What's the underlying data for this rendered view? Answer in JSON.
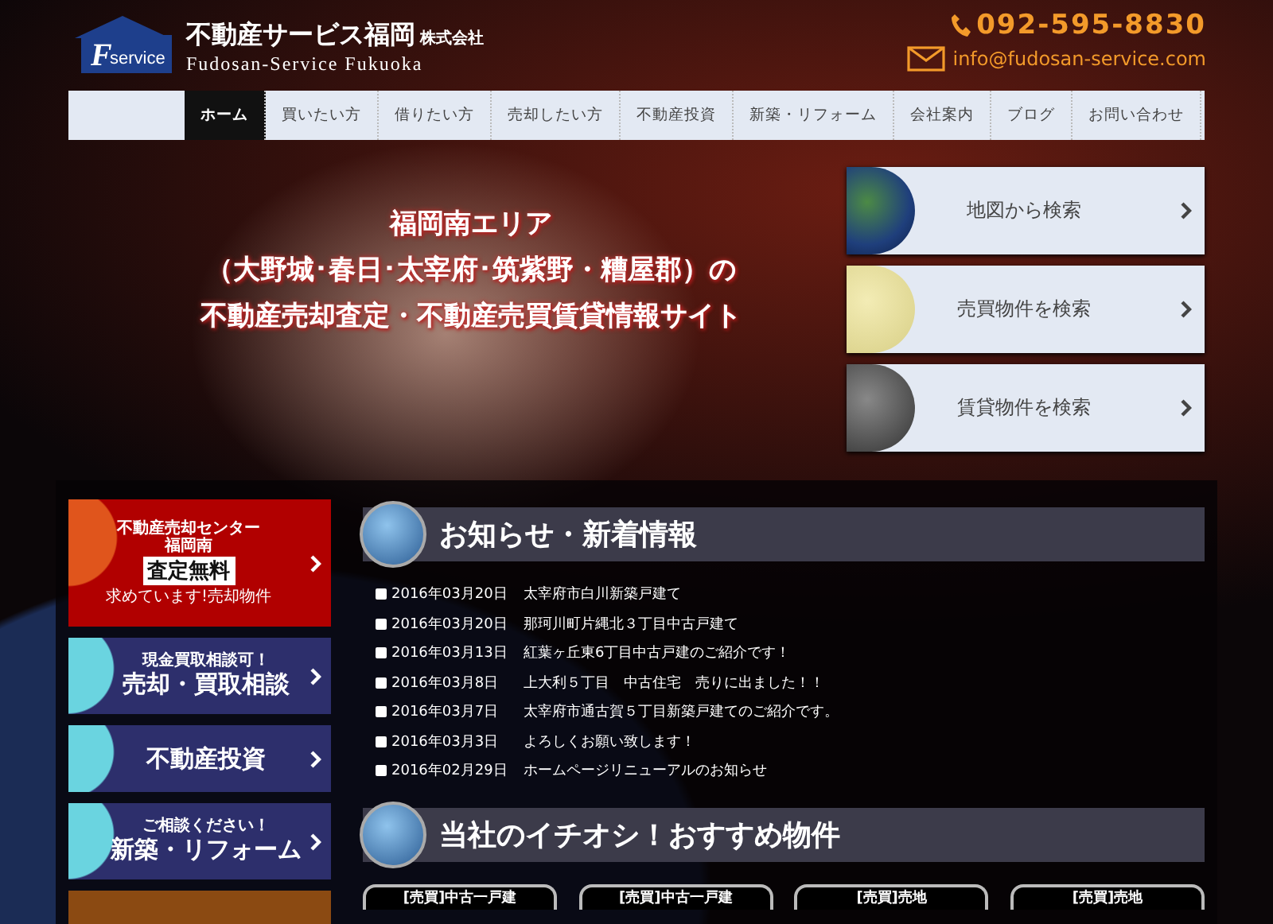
{
  "header": {
    "logo_text": "service",
    "logo_letter": "F",
    "company": "不動産サービス福岡",
    "company_suffix": "株式会社",
    "company_en": "Fudosan-Service Fukuoka",
    "phone": "092-595-8830",
    "email": "info@fudosan-service.com"
  },
  "nav": [
    {
      "label": "ホーム",
      "selected": true
    },
    {
      "label": "買いたい方",
      "selected": false
    },
    {
      "label": "借りたい方",
      "selected": false
    },
    {
      "label": "売却したい方",
      "selected": false
    },
    {
      "label": "不動産投資",
      "selected": false
    },
    {
      "label": "新築・リフォーム",
      "selected": false
    },
    {
      "label": "会社案内",
      "selected": false
    },
    {
      "label": "ブログ",
      "selected": false
    },
    {
      "label": "お問い合わせ",
      "selected": false
    }
  ],
  "hero": {
    "lines": [
      "福岡南エリア",
      "（大野城･春日･太宰府･筑紫野・糟屋郡）の",
      "不動産売却査定・不動産売買賃貸情報サイト"
    ]
  },
  "search_buttons": [
    {
      "label": "地図から検索",
      "kind": "earth"
    },
    {
      "label": "売買物件を検索",
      "kind": "moon"
    },
    {
      "label": "賃貸物件を検索",
      "kind": "rock"
    }
  ],
  "side_banners": [
    {
      "kind": "red",
      "lines": [
        "不動産売却センター",
        "福岡南"
      ],
      "title": "査定無料",
      "subtitle": "求めています!売却物件"
    },
    {
      "kind": "blue",
      "tagline": "現金買取相談可！",
      "title": "売却・買取相談"
    },
    {
      "kind": "blue",
      "title": "不動産投資"
    },
    {
      "kind": "blue",
      "tagline": "ご相談ください！",
      "title": "新築・リフォーム"
    },
    {
      "kind": "orange"
    }
  ],
  "news": {
    "heading": "お知らせ・新着情報",
    "items": [
      {
        "date": "2016年03月20日",
        "text": "太宰府市白川新築戸建て"
      },
      {
        "date": "2016年03月20日",
        "text": "那珂川町片縄北３丁目中古戸建て"
      },
      {
        "date": "2016年03月13日",
        "text": "紅葉ヶ丘東6丁目中古戸建のご紹介です！"
      },
      {
        "date": "2016年03月8日",
        "text": "上大利５丁目　中古住宅　売りに出ました！！"
      },
      {
        "date": "2016年03月7日",
        "text": "太宰府市通古賀５丁目新築戸建てのご紹介です。"
      },
      {
        "date": "2016年03月3日",
        "text": "よろしくお願い致します！"
      },
      {
        "date": "2016年02月29日",
        "text": "ホームページリニューアルのお知らせ"
      }
    ]
  },
  "featured": {
    "heading": "当社のイチオシ！おすすめ物件",
    "tabs": [
      "[売買]中古一戸建",
      "[売買]中古一戸建",
      "[売買]売地",
      "[売買]売地"
    ]
  }
}
